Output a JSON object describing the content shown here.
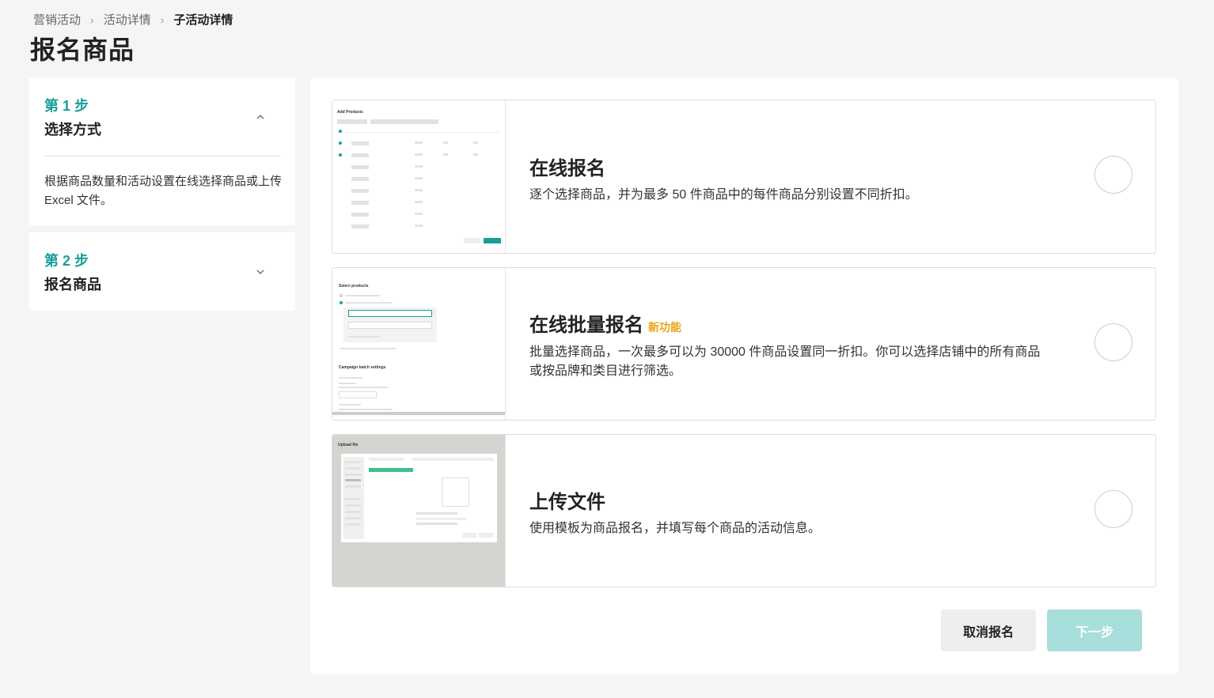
{
  "breadcrumb": {
    "item1": "营销活动",
    "item2": "活动详情",
    "current": "子活动详情"
  },
  "page_title": "报名商品",
  "steps": [
    {
      "number": "第 1 步",
      "name": "选择方式",
      "description": "根据商品数量和活动设置在线选择商品或上传 Excel 文件。",
      "state": "expanded",
      "chevron_icon": "chevron-up-icon"
    },
    {
      "number": "第 2 步",
      "name": "报名商品",
      "state": "collapsed",
      "chevron_icon": "chevron-down-icon"
    }
  ],
  "options": [
    {
      "title": "在线报名",
      "badge": "",
      "description": "逐个选择商品，并为最多 50 件商品中的每件商品分别设置不同折扣。",
      "thumbnail_title": "Add Products",
      "selected": false
    },
    {
      "title": "在线批量报名",
      "badge": "新功能",
      "description": "批量选择商品，一次最多可以为 30000 件商品设置同一折扣。你可以选择店铺中的所有商品或按品牌和类目进行筛选。",
      "thumbnail_title": "Select products",
      "thumbnail_subtitle": "Campaign batch settings",
      "selected": false
    },
    {
      "title": "上传文件",
      "badge": "",
      "description": "使用模板为商品报名，并填写每个商品的活动信息。",
      "thumbnail_title": "Upload file",
      "selected": false
    }
  ],
  "actions": {
    "cancel_label": "取消报名",
    "next_label": "下一步"
  },
  "colors": {
    "accent": "#1a9e9a",
    "badge": "#e8a317",
    "next_disabled": "#a8dedb"
  }
}
